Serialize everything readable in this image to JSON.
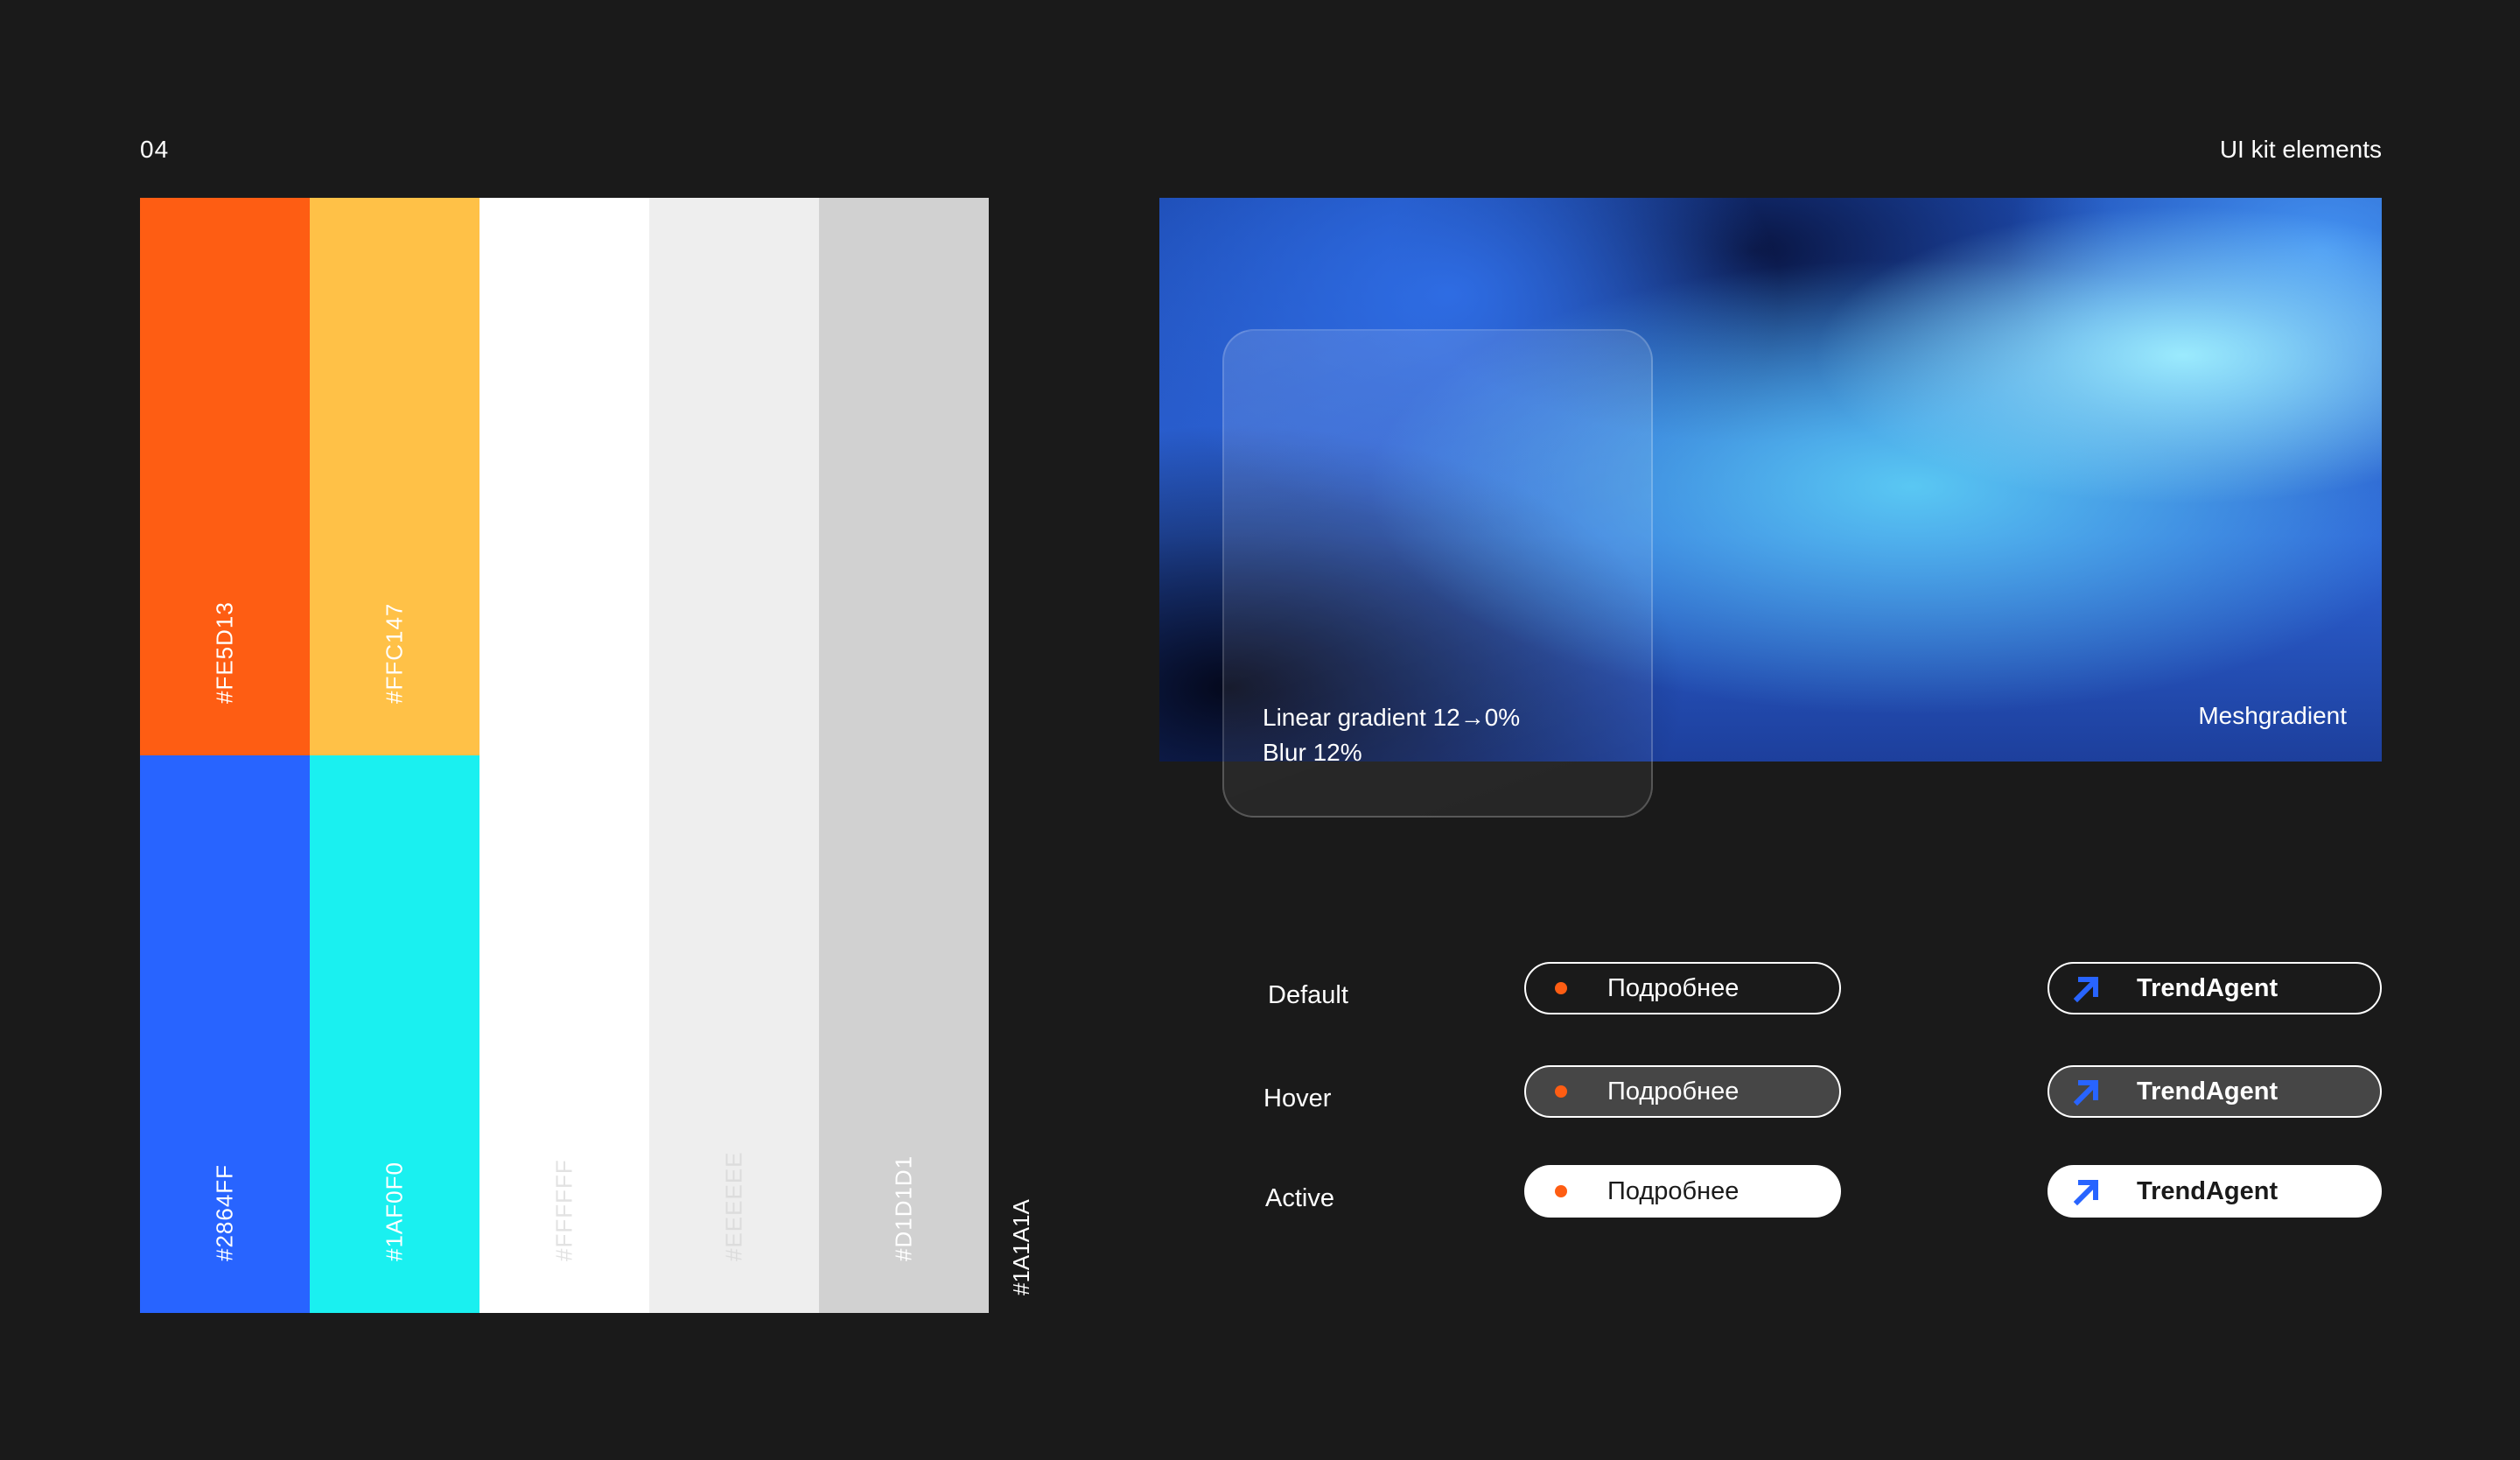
{
  "page_number": "04",
  "page_title": "UI kit elements",
  "palette": [
    {
      "hex": "#FE5D13",
      "color": "#FE5D13",
      "text_color": "#ffffff"
    },
    {
      "hex": "#FFC147",
      "color": "#FFC147",
      "text_color": "#ffffff"
    },
    {
      "hex": "#2864FF",
      "color": "#2864FF",
      "text_color": "#ffffff"
    },
    {
      "hex": "#1AF0F0",
      "color": "#1AF0F0",
      "text_color": "#ffffff"
    },
    {
      "hex": "#FFFFFF",
      "color": "#FFFFFF",
      "text_color": "#e2e2e2"
    },
    {
      "hex": "#EEEEEE",
      "color": "#EEEEEE",
      "text_color": "#dcdcdc"
    },
    {
      "hex": "#D1D1D1",
      "color": "#D1D1D1",
      "text_color": "#ffffff"
    },
    {
      "hex": "#1A1A1A",
      "color": "#1A1A1A",
      "text_color": "#ffffff"
    }
  ],
  "gradient": {
    "glass_line1": "Linear gradient 12→0%",
    "glass_line2": "Blur 12%",
    "mesh_label": "Meshgradient"
  },
  "states": {
    "default_label": "Default",
    "hover_label": "Hover",
    "active_label": "Active"
  },
  "buttons": {
    "more_label": "Подробнее",
    "brand_label": "TrendAgent",
    "dot_color": "#FE5D13",
    "arrow_color": "#2864FF",
    "arrow_icon": "arrow-up-right-icon"
  }
}
